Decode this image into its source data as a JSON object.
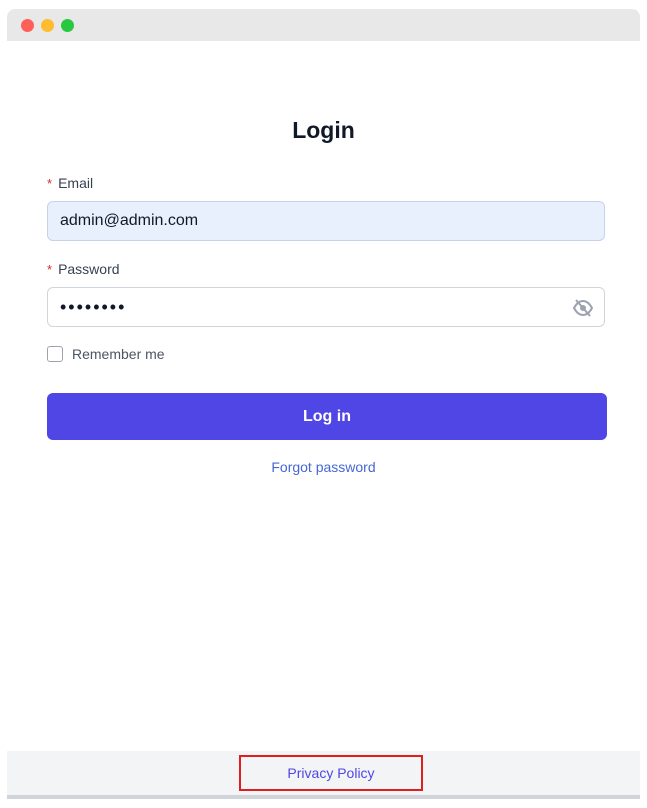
{
  "page": {
    "title": "Login"
  },
  "form": {
    "email": {
      "label": "Email",
      "required_mark": "*",
      "value": "admin@admin.com"
    },
    "password": {
      "label": "Password",
      "required_mark": "*",
      "value": "••••••••",
      "toggle_icon": "eye-slash-icon"
    },
    "remember": {
      "label": "Remember me",
      "checked": false
    },
    "submit_label": "Log in",
    "forgot_label": "Forgot password"
  },
  "footer": {
    "privacy_label": "Privacy Policy"
  },
  "colors": {
    "accent": "#4f46e5",
    "link": "#4567d6",
    "required": "#dc2626",
    "highlight_box": "#e11d1d"
  }
}
